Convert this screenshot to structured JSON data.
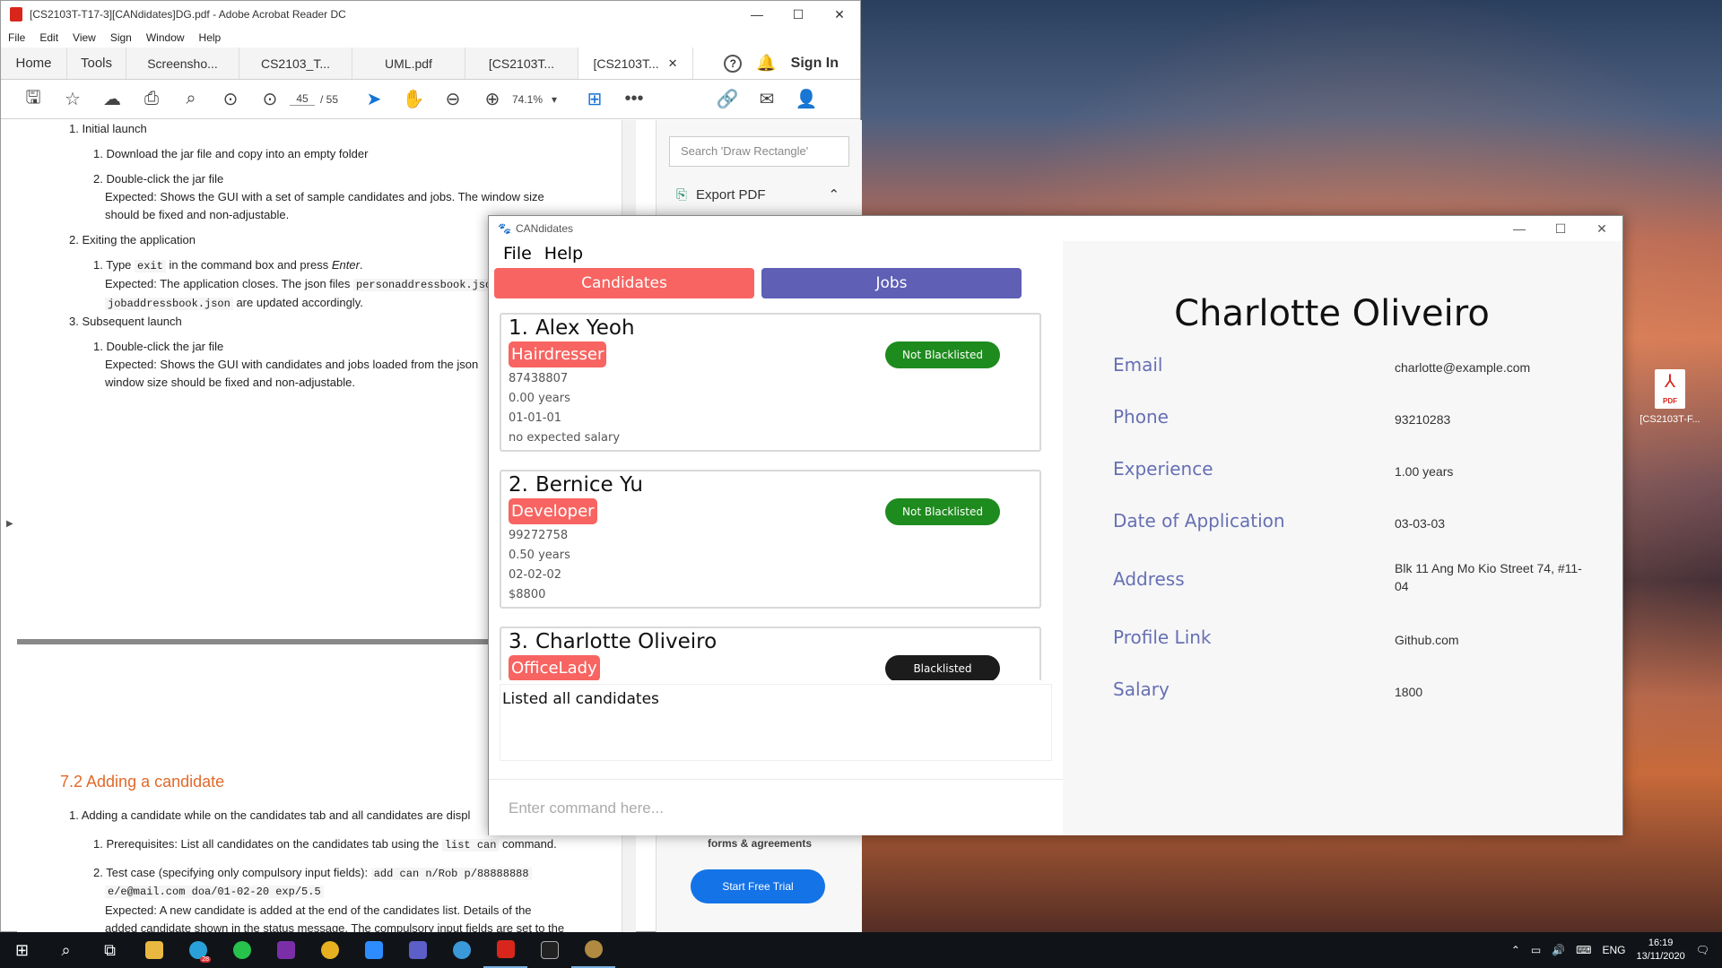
{
  "acrobat": {
    "title": "[CS2103T-T17-3][CANdidates]DG.pdf - Adobe Acrobat Reader DC",
    "menu": [
      "File",
      "Edit",
      "View",
      "Sign",
      "Window",
      "Help"
    ],
    "tabs": {
      "home": "Home",
      "tools": "Tools",
      "docs": [
        "Screensho...",
        "CS2103_T...",
        "UML.pdf",
        "[CS2103T..."
      ],
      "active": "[CS2103T..."
    },
    "sign_in": "Sign In",
    "help": "?",
    "page_current": "45",
    "page_total": "/ 55",
    "zoom": "74.1%",
    "search_placeholder": "Search 'Draw Rectangle'",
    "export_pdf": "Export PDF",
    "promo": "forms & agreements",
    "trial": "Start Free Trial",
    "doc": {
      "l1": "1. Initial launch",
      "l2": "1. Download the jar file and copy into an empty folder",
      "l3": "2. Double-click the jar file",
      "l4": "Expected: Shows the GUI with a set of sample candidates and jobs. The window size",
      "l5": "should be fixed and non-adjustable.",
      "l6": "2. Exiting the application",
      "l7a": "1. Type ",
      "l7code": "exit",
      "l7b": " in the command box and press ",
      "l7i": "Enter",
      "l8a": "Expected: The application closes. The json files ",
      "l8code": "personaddressbook.jso",
      "l9code": "jobaddressbook.json",
      "l9b": " are updated accordingly.",
      "l10": "3. Subsequent launch",
      "l11": "1. Double-click the jar file",
      "l12": "Expected: Shows the GUI with candidates and jobs loaded from the json",
      "l13": "window size should be fixed and non-adjustable.",
      "h72": "7.2 Adding a candidate",
      "m1": "1. Adding a candidate while on the candidates tab and all candidates are displ",
      "m2a": "1. Prerequisites: List all candidates on the candidates tab using the ",
      "m2code": "list can",
      "m2b": " command.",
      "m3a": "2. Test case (specifying only compulsory input fields): ",
      "m3code": "add can n/Rob p/88888888",
      "m4code": "e/e@mail.com doa/01-02-20 exp/5.5",
      "m5": "Expected: A new candidate is added at the end of the candidates list. Details of the",
      "m6": "added candidate shown in the status message. The compulsory input fields are set to the"
    }
  },
  "candidates_app": {
    "title": "CANdidates",
    "menu": [
      "File",
      "Help"
    ],
    "tab_candidates": "Candidates",
    "tab_jobs": "Jobs",
    "list": [
      {
        "index": "1.",
        "name": "Alex Yeoh",
        "role": "Hairdresser",
        "status": "Not Blacklisted",
        "phone": "87438807",
        "experience": "0.00 years",
        "date": "01-01-01",
        "salary": "no expected salary"
      },
      {
        "index": "2.",
        "name": "Bernice Yu",
        "role": "Developer",
        "status": "Not Blacklisted",
        "phone": "99272758",
        "experience": "0.50 years",
        "date": "02-02-02",
        "salary": "$8800"
      },
      {
        "index": "3.",
        "name": "Charlotte Oliveiro",
        "role": "OfficeLady",
        "status": "Blacklisted",
        "phone": "",
        "experience": "",
        "date": "",
        "salary": ""
      }
    ],
    "status_message": "Listed all candidates",
    "command_placeholder": "Enter command here...",
    "detail": {
      "name": "Charlotte Oliveiro",
      "fields": [
        {
          "label": "Email",
          "value": "charlotte@example.com"
        },
        {
          "label": "Phone",
          "value": "93210283"
        },
        {
          "label": "Experience",
          "value": "1.00 years"
        },
        {
          "label": "Date of Application",
          "value": "03-03-03"
        },
        {
          "label": "Address",
          "value": "Blk 11 Ang Mo Kio Street 74, #11-04"
        },
        {
          "label": "Profile Link",
          "value": "Github.com"
        },
        {
          "label": "Salary",
          "value": "1800"
        }
      ]
    },
    "colors": {
      "candidates_tab": "#f76461",
      "jobs_tab": "#5e5fb5",
      "not_blacklisted": "#1e8b1e",
      "blacklisted": "#1c1c1c",
      "label": "#6670b2"
    }
  },
  "desktop_icon": {
    "label": "[CS2103T-F..."
  },
  "taskbar": {
    "lang": "ENG",
    "time": "16:19",
    "date": "13/11/2020",
    "badge": "28"
  }
}
